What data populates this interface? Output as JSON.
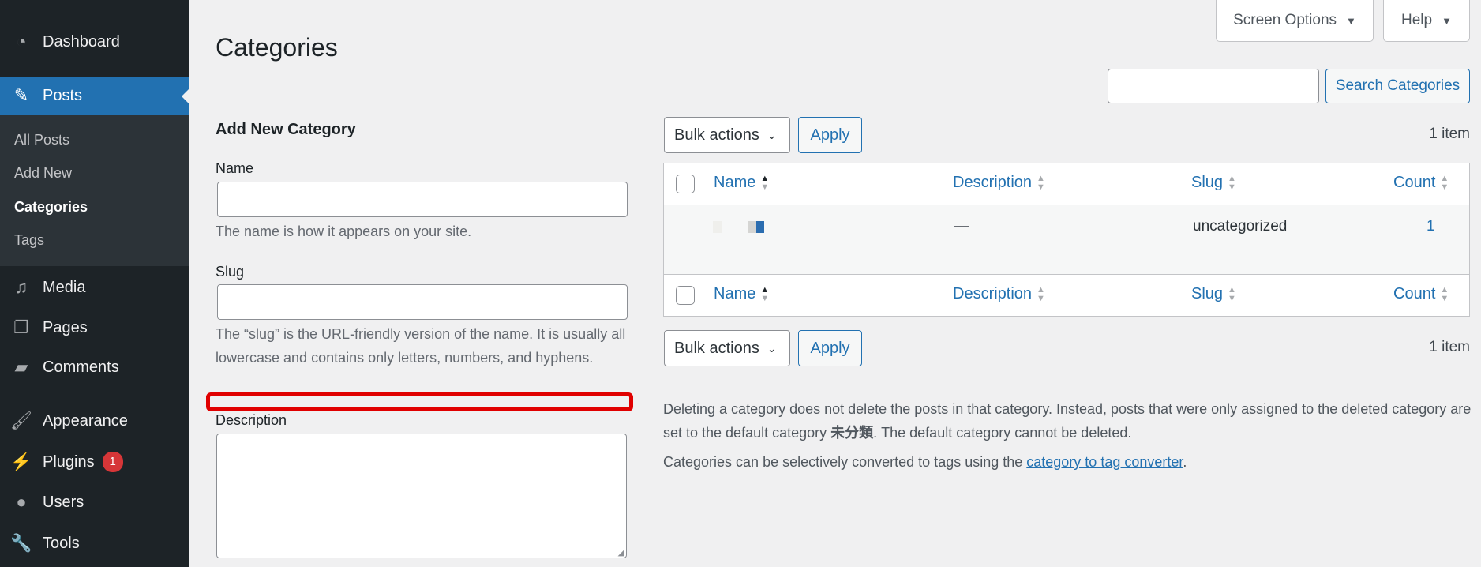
{
  "sidebar": {
    "items": [
      {
        "label": "Dashboard",
        "icon": "dashboard-icon"
      },
      {
        "label": "Posts",
        "icon": "pushpin-icon",
        "active": true
      },
      {
        "label": "Media",
        "icon": "media-icon"
      },
      {
        "label": "Pages",
        "icon": "pages-icon"
      },
      {
        "label": "Comments",
        "icon": "comment-icon"
      },
      {
        "label": "Appearance",
        "icon": "paintbrush-icon"
      },
      {
        "label": "Plugins",
        "icon": "plugin-icon",
        "badge": "1"
      },
      {
        "label": "Users",
        "icon": "user-icon"
      },
      {
        "label": "Tools",
        "icon": "wrench-icon"
      }
    ],
    "submenu": [
      "All Posts",
      "Add New",
      "Categories",
      "Tags"
    ]
  },
  "header": {
    "title": "Categories",
    "screen_options": "Screen Options",
    "help": "Help"
  },
  "search": {
    "value": "",
    "button": "Search Categories"
  },
  "form": {
    "heading": "Add New Category",
    "name_label": "Name",
    "name_value": "",
    "name_help": "The name is how it appears on your site.",
    "slug_label": "Slug",
    "slug_value": "",
    "slug_help": "The “slug” is the URL-friendly version of the name. It is usually all lowercase and contains only letters, numbers, and hyphens.",
    "description_label": "Description",
    "description_value": ""
  },
  "list": {
    "bulk_actions": "Bulk actions",
    "apply": "Apply",
    "count_text": "1 item",
    "columns": [
      "Name",
      "Description",
      "Slug",
      "Count"
    ],
    "rows": [
      {
        "name": "",
        "description": "—",
        "slug": "uncategorized",
        "count": "1"
      }
    ]
  },
  "notes": {
    "p1_a": "Deleting a category does not delete the posts in that category. Instead, posts that were only assigned to the deleted category are set to the default category ",
    "default_category": "未分類",
    "p1_b": ". The default category cannot be deleted.",
    "p2_a": "Categories can be selectively converted to tags using the ",
    "p2_link": "category to tag converter",
    "p2_b": "."
  },
  "colors": {
    "accent": "#2271b1",
    "sidebar": "#1d2327",
    "highlight": "#e00000"
  }
}
